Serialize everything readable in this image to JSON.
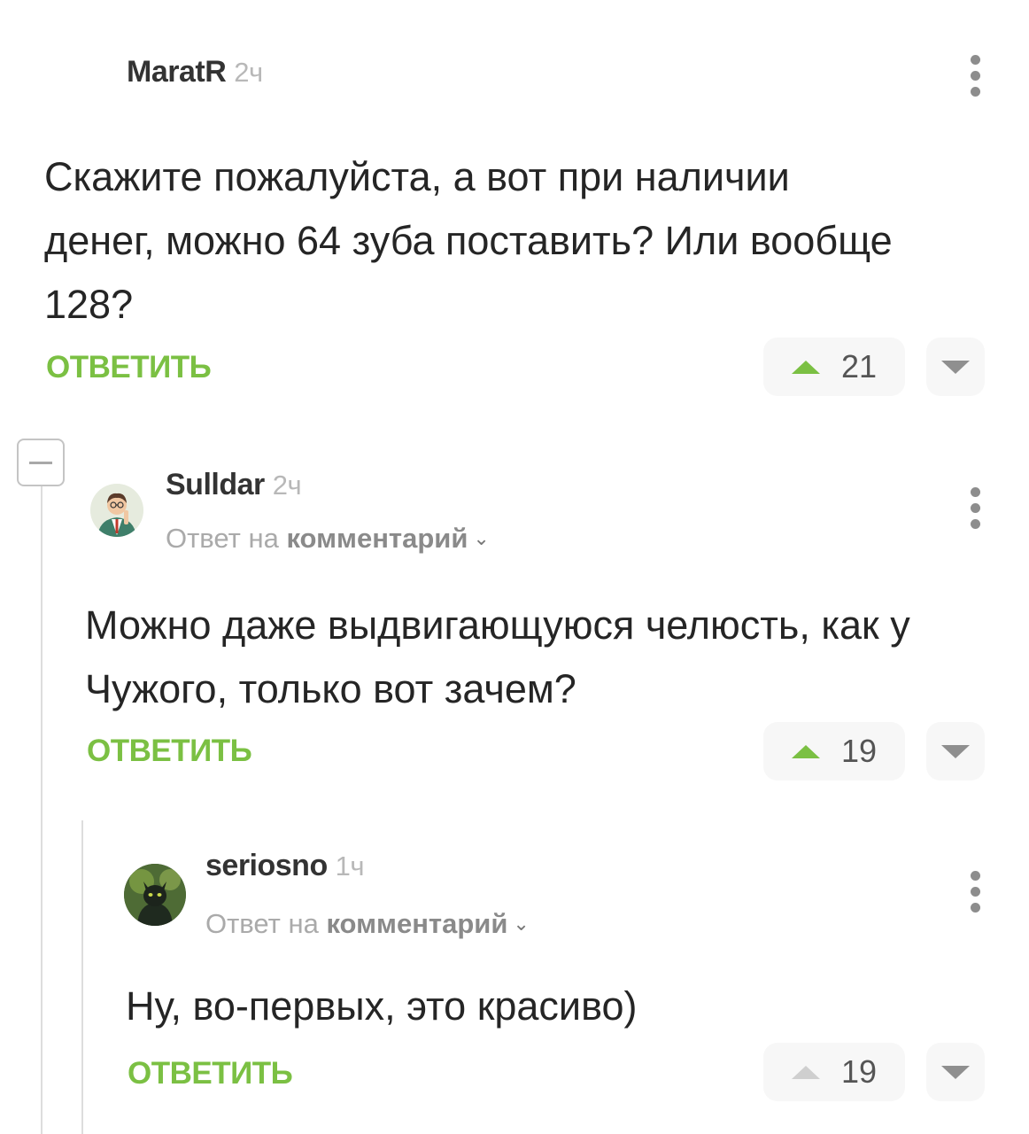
{
  "comments": [
    {
      "author": "MaratR",
      "time": "2ч",
      "text": "Скажите пожалуйста, а вот при наличии денег, можно 64 зуба поставить? Или вообще 128?",
      "reply_label": "ОТВЕТИТЬ",
      "votes": "21"
    },
    {
      "author": "Sulldar",
      "time": "2ч",
      "reply_to_prefix": "Ответ на",
      "reply_to_link": "комментарий",
      "text": "Можно даже выдвигающуюся челюсть, как у Чужого, только вот зачем?",
      "reply_label": "ОТВЕТИТЬ",
      "votes": "19"
    },
    {
      "author": "seriosno",
      "time": "1ч",
      "reply_to_prefix": "Ответ на",
      "reply_to_link": "комментарий",
      "text": "Ну, во-первых, это красиво)",
      "reply_label": "ОТВЕТИТЬ",
      "votes": "19"
    }
  ],
  "icons": {
    "menu": "more-vertical-icon",
    "upvote": "triangle-up-icon",
    "downvote": "triangle-down-icon",
    "collapse": "minus-icon",
    "chevron": "chevron-down-icon"
  },
  "colors": {
    "accent_green": "#7bc043",
    "vote_bg": "#f7f7f7",
    "muted_text": "#aaaaaa"
  }
}
